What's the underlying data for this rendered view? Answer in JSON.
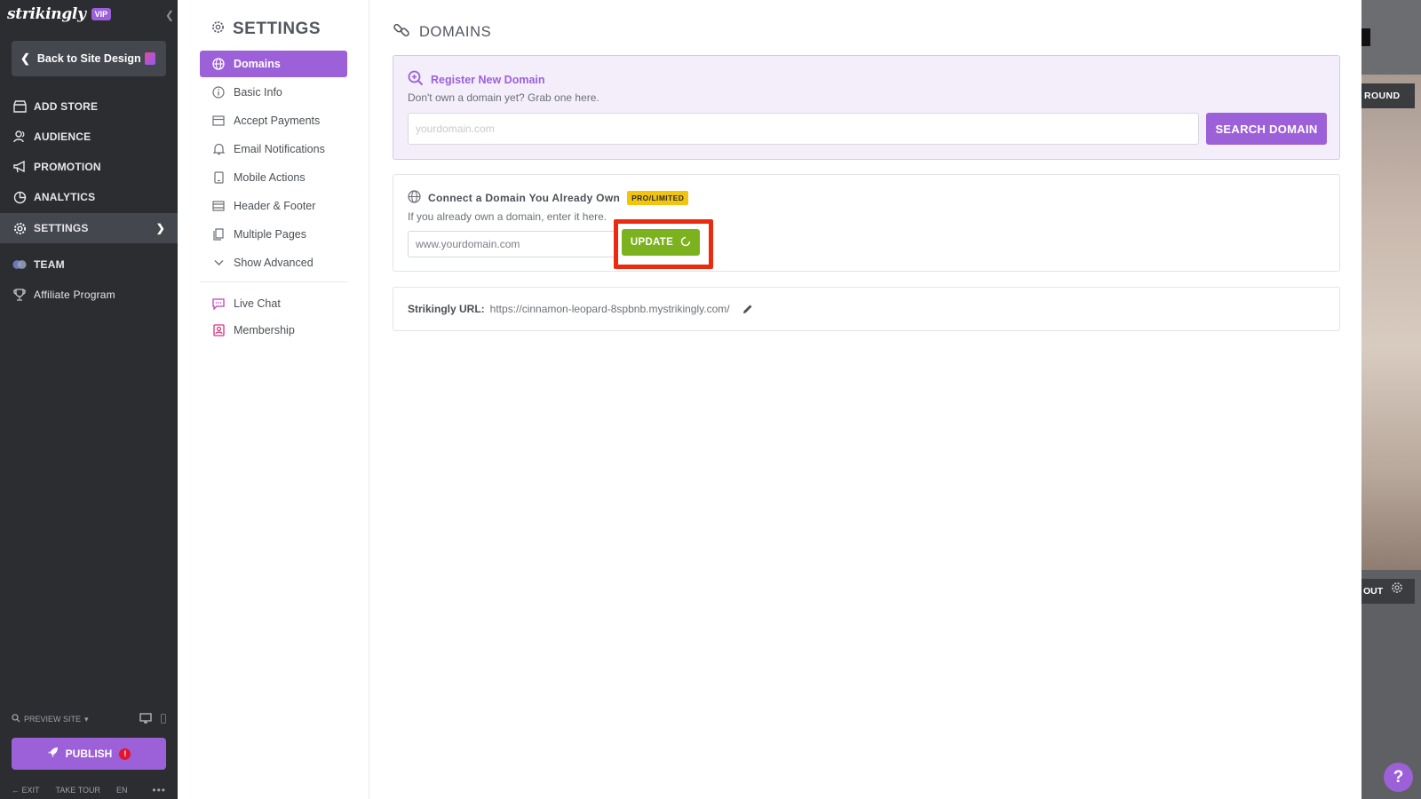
{
  "brand": {
    "logo": "strikingly",
    "badge": "VIP"
  },
  "left_nav": {
    "back_label": "Back to Site Design",
    "items": [
      {
        "label": "ADD STORE",
        "icon": "store-icon"
      },
      {
        "label": "AUDIENCE",
        "icon": "audience-icon"
      },
      {
        "label": "PROMOTION",
        "icon": "megaphone-icon"
      },
      {
        "label": "ANALYTICS",
        "icon": "pie-chart-icon"
      },
      {
        "label": "SETTINGS",
        "icon": "gear-icon",
        "active": true
      },
      {
        "label": "TEAM",
        "icon": "team-icon"
      },
      {
        "label": "Affiliate Program",
        "icon": "trophy-icon"
      }
    ],
    "preview_label": "PREVIEW SITE",
    "publish_label": "PUBLISH",
    "publish_alert": "!",
    "footer": {
      "exit": "EXIT",
      "tour": "TAKE TOUR",
      "lang": "EN",
      "more": "•••"
    }
  },
  "settings_nav": {
    "title": "SETTINGS",
    "items": [
      {
        "label": "Domains",
        "icon": "globe-icon",
        "active": true
      },
      {
        "label": "Basic Info",
        "icon": "info-icon"
      },
      {
        "label": "Accept Payments",
        "icon": "card-icon"
      },
      {
        "label": "Email Notifications",
        "icon": "bell-icon"
      },
      {
        "label": "Mobile Actions",
        "icon": "mobile-icon"
      },
      {
        "label": "Header & Footer",
        "icon": "layout-icon"
      },
      {
        "label": "Multiple Pages",
        "icon": "pages-icon"
      },
      {
        "label": "Show Advanced",
        "icon": "chevron-down-icon"
      }
    ],
    "extra_items": [
      {
        "label": "Live Chat",
        "icon": "chat-icon"
      },
      {
        "label": "Membership",
        "icon": "member-icon"
      }
    ]
  },
  "main": {
    "title": "DOMAINS",
    "register": {
      "heading": "Register New Domain",
      "subtext": "Don't own a domain yet? Grab one here.",
      "placeholder": "yourdomain.com",
      "button": "SEARCH DOMAIN"
    },
    "connect": {
      "heading": "Connect a Domain You Already Own",
      "badge": "PRO/LIMITED",
      "subtext": "If you already own a domain, enter it here.",
      "placeholder": "www.yourdomain.com",
      "button": "UPDATE"
    },
    "url": {
      "label": "Strikingly URL:",
      "value": "https://cinnamon-leopard-8spbnb.mystrikingly.com/"
    }
  },
  "preview_strip": {
    "round_btn": "ROUND",
    "out_btn": "OUT"
  },
  "help": "?",
  "colors": {
    "accent": "#9c61d8",
    "update_green": "#7cb21e",
    "highlight_red": "#ea2b10",
    "sidebar_dark": "#2c2d31",
    "badge_yellow": "#f2c40e"
  }
}
